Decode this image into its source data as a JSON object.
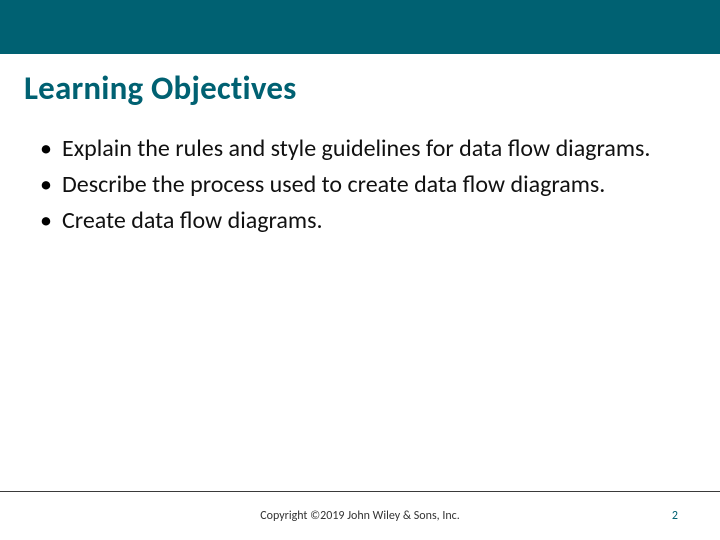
{
  "colors": {
    "accent": "#006172"
  },
  "header": {
    "title": "Learning Objectives"
  },
  "body": {
    "items": [
      "Explain the rules and style guidelines for data flow diagrams.",
      "Describe the process used to create data flow diagrams.",
      "Create data flow diagrams."
    ]
  },
  "footer": {
    "copyright": "Copyright ©2019 John Wiley & Sons, Inc.",
    "page_number": "2"
  }
}
